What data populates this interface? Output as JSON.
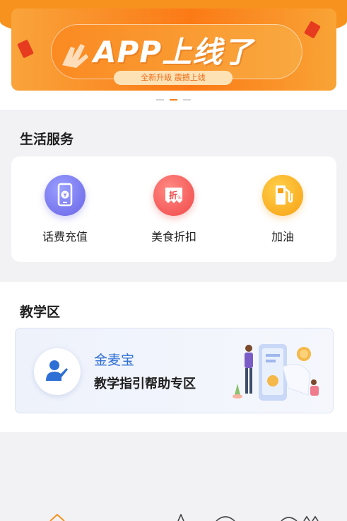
{
  "banner": {
    "title": "APP上线了",
    "subtitle": "全新升级  震撼上线",
    "pages": 3,
    "active_page": 2
  },
  "life_services": {
    "title": "生活服务",
    "items": [
      {
        "label": "话费充值",
        "icon": "phone-recharge-icon",
        "color": "#6a63e6"
      },
      {
        "label": "美食折扣",
        "icon": "discount-tag-icon",
        "color": "#f04848"
      },
      {
        "label": "加油",
        "icon": "fuel-pump-icon",
        "color": "#f7a013"
      }
    ]
  },
  "teaching": {
    "title": "教学区",
    "brand": "金麦宝",
    "description": "教学指引帮助专区"
  },
  "colors": {
    "accent": "#f7921e",
    "brand_blue": "#2e6fd6"
  }
}
